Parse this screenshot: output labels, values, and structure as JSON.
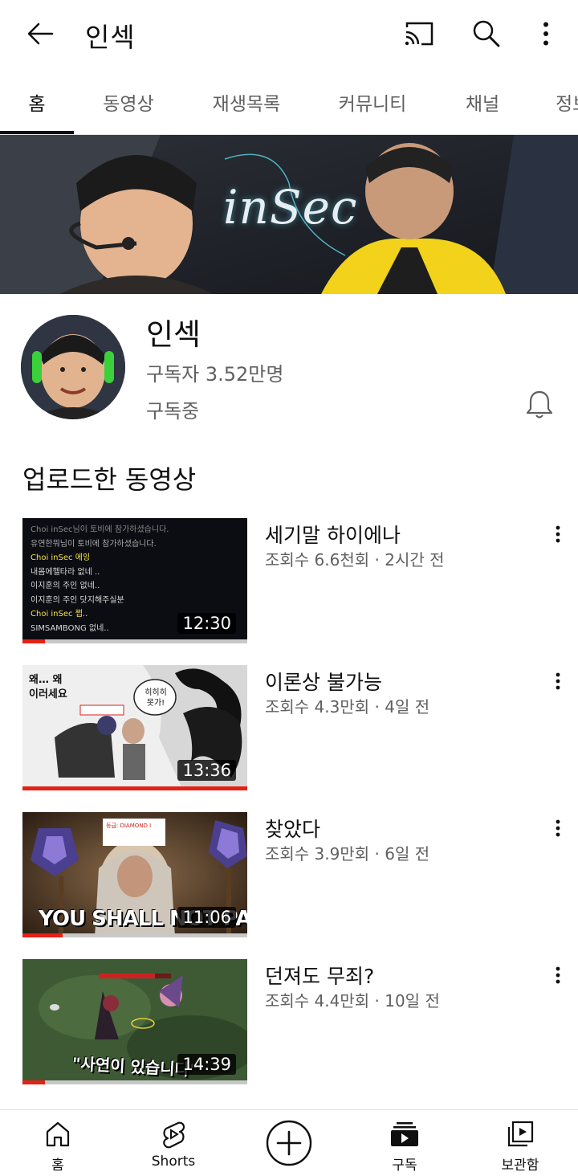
{
  "appbar": {
    "title": "인섹",
    "icons": [
      "back-arrow-icon",
      "cast-icon",
      "search-icon",
      "more-vert-icon"
    ]
  },
  "tabs": [
    {
      "label": "홈",
      "active": true
    },
    {
      "label": "동영상",
      "active": false
    },
    {
      "label": "재생목록",
      "active": false
    },
    {
      "label": "커뮤니티",
      "active": false
    },
    {
      "label": "채널",
      "active": false
    },
    {
      "label": "정보",
      "active": false
    }
  ],
  "banner": {
    "text": "inSec"
  },
  "channel": {
    "name": "인섹",
    "subscribers": "구독자 3.52만명",
    "status": "구독중"
  },
  "section": {
    "title": "업로드한 동영상"
  },
  "videos": [
    {
      "title": "세기말 하이에나",
      "meta": "조회수 6.6천회 · 2시간 전",
      "duration": "12:30",
      "progress": 0.1,
      "thumb_lines": [
        "Choi inSec님이 토비에 참가하셨습니다.",
        "유연한뭐님이 토비에 참가하셨습니다.",
        "Choi inSec 에잉",
        "내몸에헬타라 없네 ..",
        "이지훈의 주인 없네..",
        "이지훈의 주인 닷지해주실분",
        "Choi inSec 쩝..",
        "SIMSAMBONG 없네.."
      ]
    },
    {
      "title": "이론상 불가능",
      "meta": "조회수 4.3만회 · 4일 전",
      "duration": "13:36",
      "progress": 1.0,
      "thumb_lines": [
        "왜… 왜",
        "이러세요",
        "히히히",
        "못가!"
      ]
    },
    {
      "title": "찾았다",
      "meta": "조회수 3.9만회 · 6일 전",
      "duration": "11:06",
      "progress": 0.18,
      "thumb_lines": [
        "YOU SHALL NOT PASS",
        "등급: DIAMOND I"
      ]
    },
    {
      "title": "던져도 무죄?",
      "meta": "조회수 4.4만회 · 10일 전",
      "duration": "14:39",
      "progress": 0.1,
      "thumb_lines": [
        "\"사연이 있습니다\""
      ]
    }
  ],
  "bottom_nav": [
    {
      "label": "홈",
      "icon": "home-icon"
    },
    {
      "label": "Shorts",
      "icon": "shorts-icon"
    },
    {
      "label": "",
      "icon": "create-icon"
    },
    {
      "label": "구독",
      "icon": "subscriptions-icon"
    },
    {
      "label": "보관함",
      "icon": "library-icon"
    }
  ],
  "colors": {
    "accent": "#e62117",
    "text": "#0f0f0f",
    "secondary": "#606060"
  }
}
